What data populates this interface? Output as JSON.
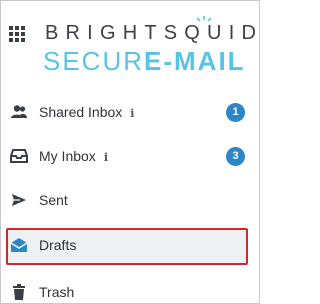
{
  "brand": {
    "top": "BRIGHTSQUID",
    "bottom_light": "SECUR",
    "bottom_bold": "E-MAIL",
    "color_dark": "#3d4248",
    "color_accent": "#59c3e6"
  },
  "nav": {
    "items": [
      {
        "label": "Shared Inbox",
        "info": "i",
        "badge": "1",
        "icon": "users-icon"
      },
      {
        "label": "My Inbox",
        "info": "i",
        "badge": "3",
        "icon": "inbox-icon"
      },
      {
        "label": "Sent",
        "icon": "paper-plane-icon"
      },
      {
        "label": "Drafts",
        "icon": "envelope-open-icon",
        "selected": true
      },
      {
        "label": "Trash",
        "icon": "trash-icon"
      }
    ],
    "badge_color": "#2e86c7",
    "highlight_color": "#d6262c"
  }
}
